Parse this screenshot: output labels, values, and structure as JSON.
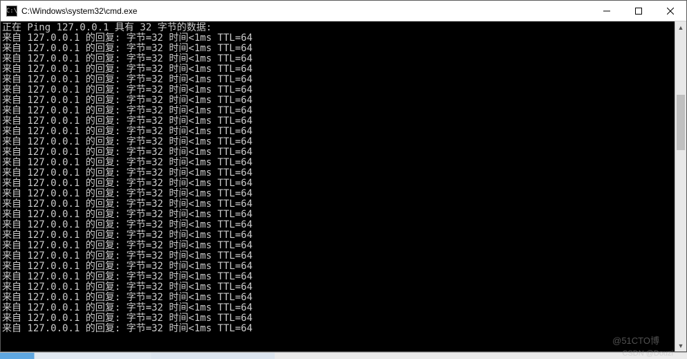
{
  "window": {
    "icon_text": "C:\\",
    "title": "C:\\Windows\\system32\\cmd.exe"
  },
  "console": {
    "header": "正在 Ping 127.0.0.1 具有 32 字节的数据:",
    "reply_template": "来自 127.0.0.1 的回复: 字节=32 时间<1ms TTL=64",
    "reply_count": 29,
    "ip": "127.0.0.1",
    "bytes": 32,
    "time": "<1ms",
    "ttl": 64
  },
  "watermarks": {
    "top": "@51CTO博",
    "bottom": "CSDN @Douzi"
  }
}
